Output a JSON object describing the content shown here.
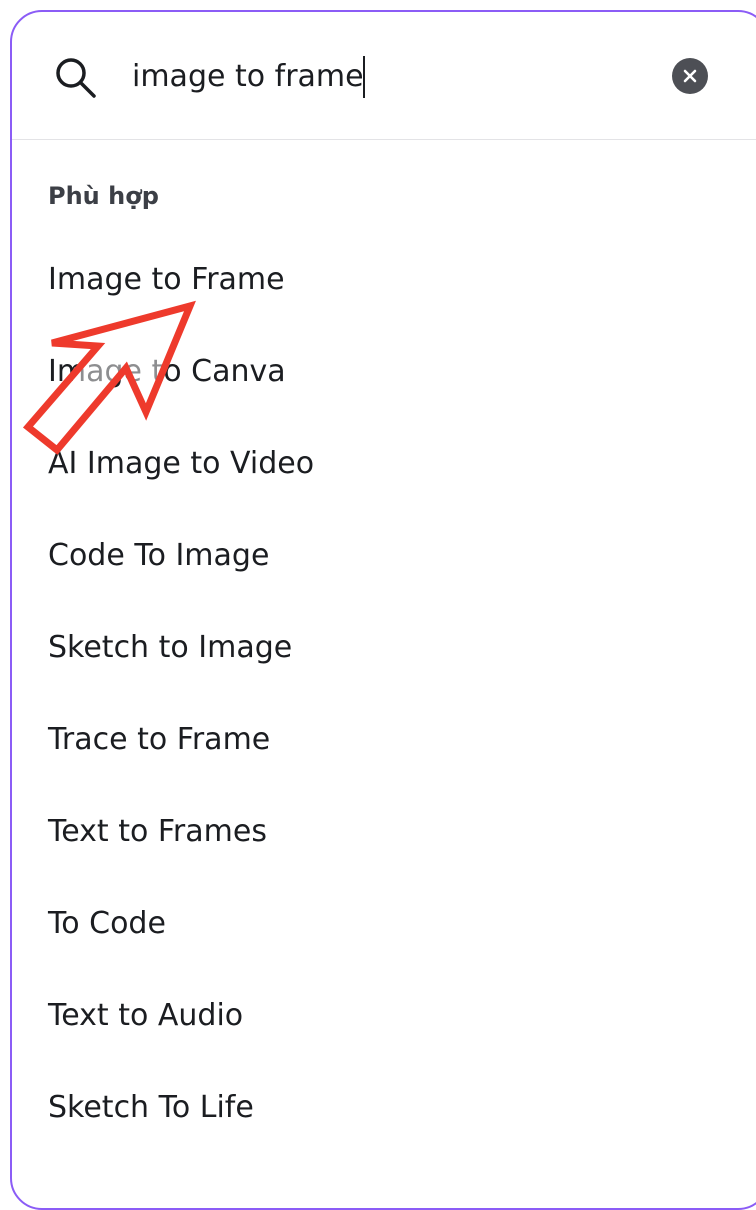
{
  "search": {
    "value": "image to frame",
    "icon": "search-icon",
    "clear_icon": "close-icon"
  },
  "section": {
    "heading": "Phù hợp"
  },
  "results": [
    "Image to Frame",
    "Image to Canva",
    "AI Image to Video",
    "Code To Image",
    "Sketch to Image",
    "Trace to Frame",
    "Text to Frames",
    "To Code",
    "Text to Audio",
    "Sketch To Life"
  ],
  "colors": {
    "panel_border": "#8b5cf6",
    "annotation_arrow": "#ee3a2c",
    "clear_button": "#4d4f55"
  }
}
